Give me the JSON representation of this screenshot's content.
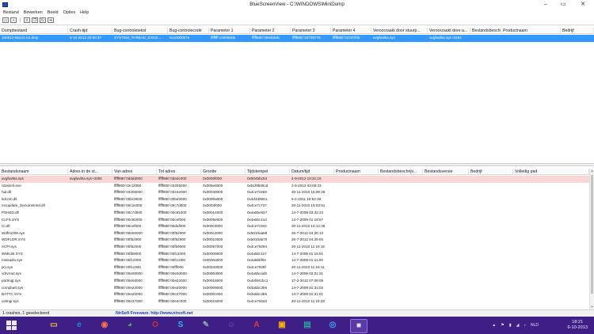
{
  "window": {
    "title": "BlueScreenView  -  C:\\WINDOWS\\MiniDump",
    "controls": [
      "–",
      "▭",
      "✕"
    ]
  },
  "menu": [
    "Bestand",
    "Bewerken",
    "Beeld",
    "Opties",
    "Help"
  ],
  "toolbar_icons": [
    "open-folder-icon",
    "save-icon",
    "properties-icon",
    "copy-icon",
    "refresh-icon",
    "exit-icon"
  ],
  "dumps": {
    "columns": [
      "Dumpbestand",
      "Crash-tijd",
      "Bug-controletekst",
      "Bug-controlecode",
      "Parameter 1",
      "Parameter 2",
      "Parameter 3",
      "Parameter 4",
      "Veroorzaakt door stuurp...",
      "Veroorzaakt door a...",
      "Bestandsbeschrijving",
      "Productnaam",
      "Bedrijf"
    ],
    "rows": [
      [
        "100613-56241-01.dmp",
        "6-10-2013 20:00:37",
        "SYSTEM_THREAD_EXCE...",
        "0x1000007e",
        "ffffffff c0000005",
        "fffff880`0564b59c",
        "fffff880`037d8778",
        "fffff880`037d7fd0",
        "avgfwd6a.sys",
        "avgfwd6a.sys+3282",
        "",
        "",
        ""
      ]
    ]
  },
  "drivers": {
    "columns": [
      "Bestandsnaam",
      "Adres in de st...",
      "Van adres",
      "Tot adres",
      "Grootte",
      "Tijdstempel",
      "Datum/tijd",
      "Productnaam",
      "Bestandsbeschrijv...",
      "Bestandsversie",
      "Bedrijf",
      "Volledig pad"
    ],
    "rows": [
      [
        "avgfwd6a.sys",
        "avgfwd6a.sys+3282",
        "fffff880`0dddd000",
        "fffff880`0dedc000",
        "0x0000f000",
        "0x5045bc53",
        "4-9-2012 10:31:15"
      ],
      [
        "ntoskrnl.exe",
        "",
        "fffff800`02c1f000",
        "fffff800`03205000",
        "0x005e6000",
        "0x51f9b06cd",
        "2-8-2013 03:09:33"
      ],
      [
        "hal.dll",
        "",
        "fffff800`03205000",
        "fffff800`0324e000",
        "0x00049000",
        "0x4ce7c669",
        "20-11-2010 15:00:25"
      ],
      [
        "kdcom.dll",
        "",
        "fffff880`00bc9000",
        "fffff880`00bd3000",
        "0x0000a000",
        "0x4d4d8061",
        "5-2-2011 18:52:49"
      ],
      [
        "mcupdate_GenuineIntel.dll",
        "",
        "fffff880`00c2e000",
        "fffff880`00c7d000",
        "0x0004f000",
        "0x4ce7c737",
        "20-11-2010 15:03:51"
      ],
      [
        "PSHED.dll",
        "",
        "fffff880`00c7d000",
        "fffff880`00c91000",
        "0x00014000",
        "0x4a5be027",
        "14-7-2009 03:32:23"
      ],
      [
        "CLFS.SYS",
        "",
        "fffff880`00c91000",
        "fffff880`00cef000",
        "0x0005e000",
        "0x4a5bc11d",
        "14-7-2009 01:19:57"
      ],
      [
        "CI.dll",
        "",
        "fffff880`00cef000",
        "fffff880`00daf000",
        "0x000c0000",
        "0x4ce7c944",
        "20-11-2010 15:12:36"
      ],
      [
        "Wdf01000.sys",
        "",
        "fffff880`00e00000",
        "fffff880`00f52000",
        "0x000c2000",
        "0x5010aa89",
        "26-7-2012 04:25:13"
      ],
      [
        "WDFLDR.SYS",
        "",
        "fffff880`00f52000",
        "fffff880`00f62000",
        "0x00010000",
        "0x5010ab70",
        "26-7-2012 04:29:04"
      ],
      [
        "ACPI.sys",
        "",
        "fffff880`00f62000",
        "fffff880`00fb9000",
        "0x00057000",
        "0x4ce79294",
        "20-11-2010 11:19:16"
      ],
      [
        "WMILIB.SYS",
        "",
        "fffff880`00fb9000",
        "fffff880`00fc2000",
        "0x00009000",
        "0x4a5bc117",
        "14-7-2009 01:19:51"
      ],
      [
        "msisadrv.sys",
        "",
        "fffff880`00fc2000",
        "fffff880`00fcc000",
        "0x0000a000",
        "0x4a5bbf0e",
        "14-7-2009 01:11:09"
      ],
      [
        "pci.sys",
        "",
        "fffff880`00fcc000",
        "fffff880`00fff000",
        "0x00033000",
        "0x4ce7928f",
        "20-11-2010 11:19:11"
      ],
      [
        "vdrvroot.sys",
        "",
        "fffff880`00e00000",
        "fffff880`00e0d000",
        "0x0000d000",
        "0x4a5bcadb",
        "14-7-2009 02:01:31"
      ],
      [
        "partmgr.sys",
        "",
        "fffff880`00e0d000",
        "fffff880`00e22000",
        "0x00015000",
        "0x4ef841bc1",
        "17-3-2012 07:06:09"
      ],
      [
        "compbatt.sys",
        "",
        "fffff880`00e22000",
        "fffff880`00e2b000",
        "0x00009000",
        "0x4a5bc3b6",
        "14-7-2009 01:31:02"
      ],
      [
        "BATTC.SYS",
        "",
        "fffff880`00e2b000",
        "fffff880`00e37000",
        "0x0000c000",
        "0x4a5bc3b5",
        "14-7-2009 01:31:01"
      ],
      [
        "volmgr.sys",
        "",
        "fffff880`00e37000",
        "fffff880`00e4c000",
        "0x00015000",
        "0x4ce792a0",
        "20-11-2010 11:19:28"
      ]
    ]
  },
  "status": {
    "left": "1 crashes, 1 geselecteerd",
    "center": "NirSoft Freeware.  http://www.nirsoft.net"
  },
  "taskbar": {
    "apps": [
      "file-explorer-icon",
      "internet-explorer-icon",
      "firefox-icon",
      "chrome-icon",
      "opera-icon",
      "skype-icon",
      "wrench-tool-icon",
      "messenger-icon",
      "pdf-icon",
      "photo-icon",
      "gallery-icon",
      "remote-desktop-icon",
      "bluescreenview-icon"
    ],
    "language": "NLD",
    "time": "18:21",
    "date": "6-10-2013"
  },
  "colors": {
    "selection": "#3399ff",
    "highlight_row": "#f9d6d6",
    "taskbar": "#3e1f86"
  }
}
